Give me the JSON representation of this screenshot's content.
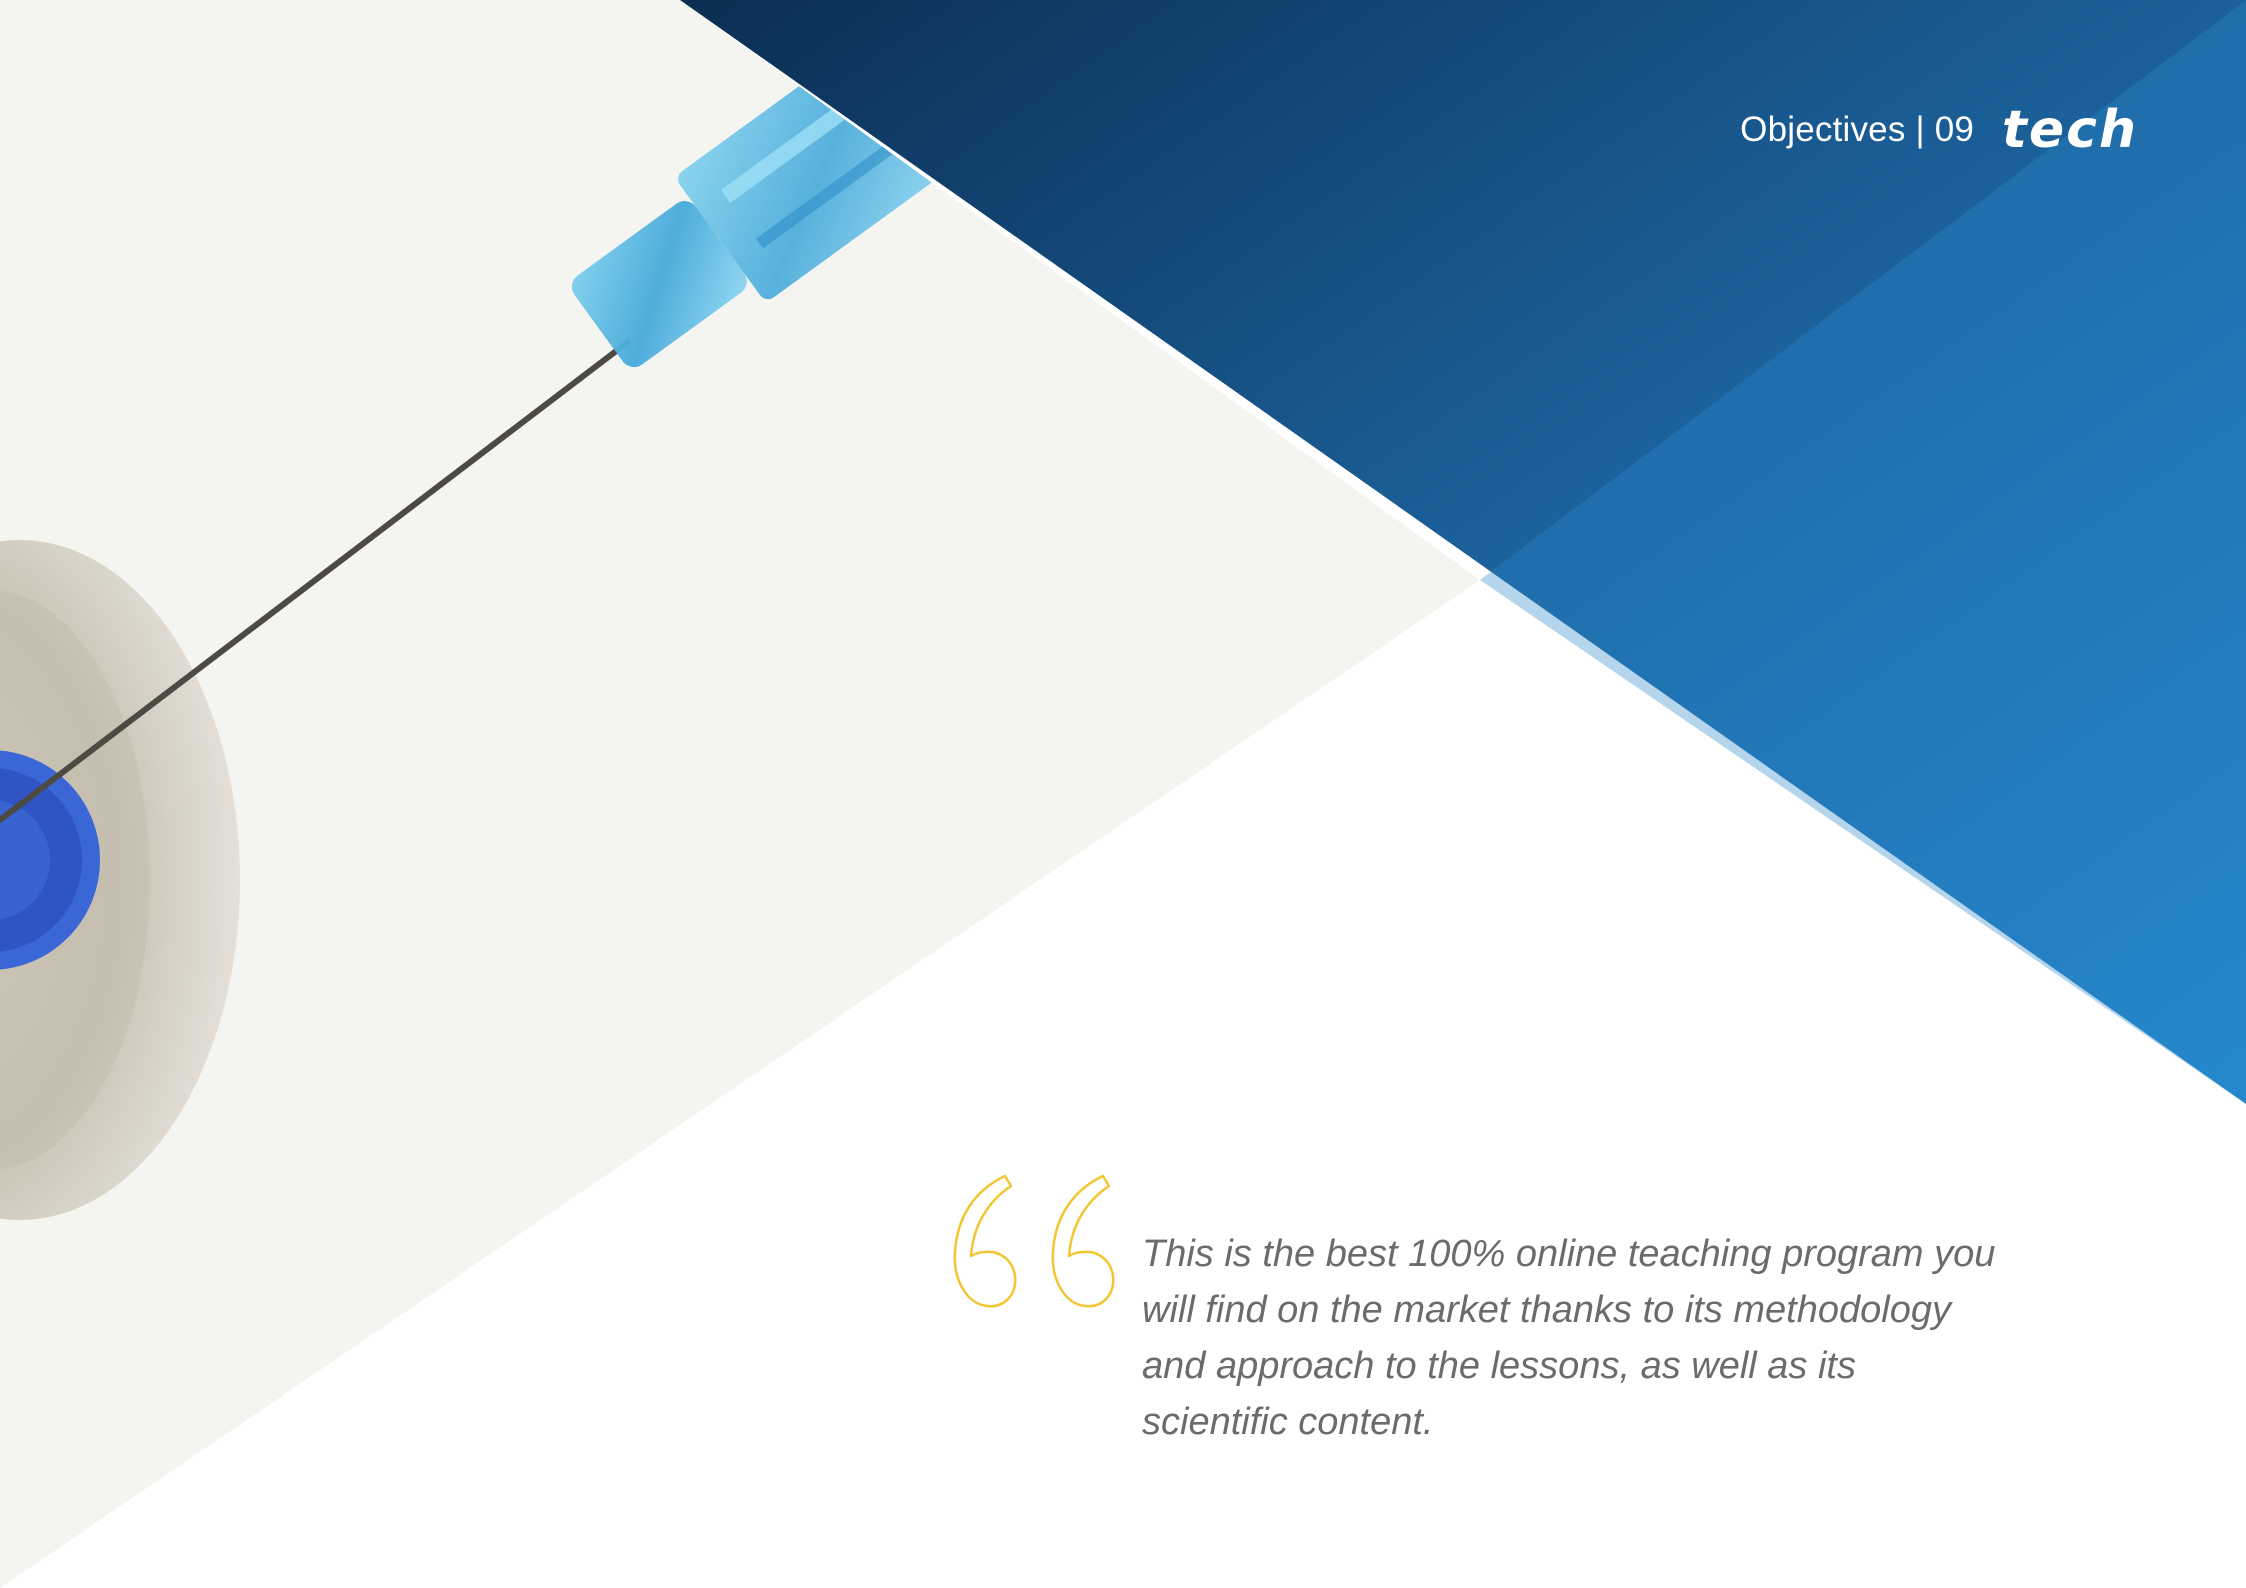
{
  "header": {
    "section_label": "Objectives | 09",
    "brand": "tech"
  },
  "quote": {
    "icon": "quote-mark-icon",
    "text": "This is the best 100% online teaching program you will find on the market thanks to its methodology and approach to the lessons, as well as its scientific content."
  },
  "colors": {
    "blue_dark": "#0b2e52",
    "blue_mid": "#1a5c94",
    "blue_light": "#2389d0",
    "quote_yellow": "#f2c531",
    "text_gray": "#6b6b6b"
  }
}
